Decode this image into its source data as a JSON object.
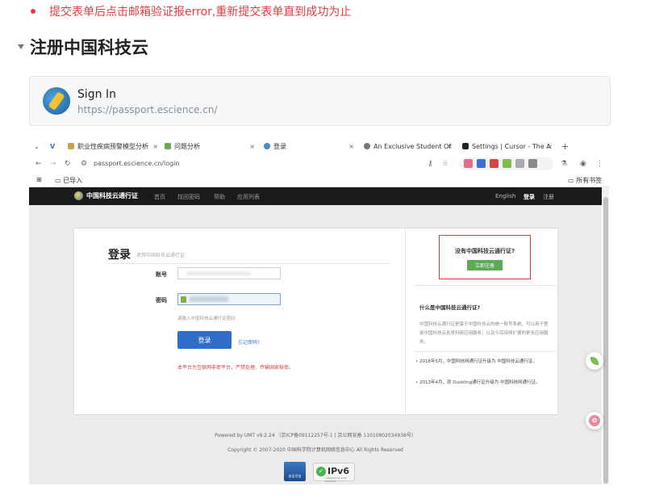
{
  "doc": {
    "bullet_text": "提交表单后点击邮箱验证报error,重新提交表单直到成功为止",
    "toggle_heading": "注册中国科技云",
    "bookmark": {
      "title": "Sign In",
      "url": "https://passport.escience.cn/"
    }
  },
  "browser": {
    "tabs": [
      {
        "label": "职业性疾病预警模型分析",
        "close": "×"
      },
      {
        "label": "问题分析",
        "close": "×"
      },
      {
        "label": "登录",
        "close": "×"
      },
      {
        "label": "An Exclusive Student Of",
        "close": "×"
      },
      {
        "label": "Settings | Cursor - The A",
        "close": "×"
      }
    ],
    "new_tab": "+",
    "url": "passport.escience.cn/login",
    "bookmarks_bar": {
      "imported": "已导入",
      "all_bookmarks": "所有书签"
    }
  },
  "site": {
    "logo_text": "中国科技云通行证",
    "nav": [
      "首页",
      "找回密码",
      "帮助",
      "应用列表"
    ],
    "nav_right": [
      "English",
      "登录",
      "注册"
    ],
    "login": {
      "title": "登录",
      "subtitle": "使用中国科技云通行证",
      "account_label": "账号",
      "password_label": "密码",
      "hint": "请输入中国科技云通行证密码",
      "login_button": "登录",
      "forgot": "忘记密码?",
      "warning": "本平台为互联网非密平台，严禁处理、传输国家秘密。"
    },
    "register": {
      "question": "没有中国科技云通行证?",
      "button": "立即注册"
    },
    "what": {
      "title": "什么是中国科技云通行证?",
      "desc": "中国科技云通行证是基于中国科技云的统一账号系统，可以用于登录中国科技云各类科研应用服务，以及今后持续扩展的更多应用服务。"
    },
    "news": [
      "2016年5月，中国科技网通行证升级为 中国科技云通行证。",
      "2013年4月，原 Duckling通行证升级为 中国科技网通行证。"
    ],
    "footer": {
      "line1": "Powered by UMT v9.2.24 （京ICP备09112257号-1 | 京公网安备 11010802034938号）",
      "line2": "Copyright © 2007-2020 中国科学院计算机网络信息中心 All Rights Reserved"
    },
    "badges": {
      "badge1": "安全可信",
      "ipv6": "IPv6",
      "ipv6_sub": "validated by ipv6-test.com"
    }
  },
  "colors": {
    "bullet_red": "#e03e3e",
    "login_blue": "#2f6ec8",
    "register_green": "#5cab54",
    "highlight_red": "#d43d3d"
  }
}
